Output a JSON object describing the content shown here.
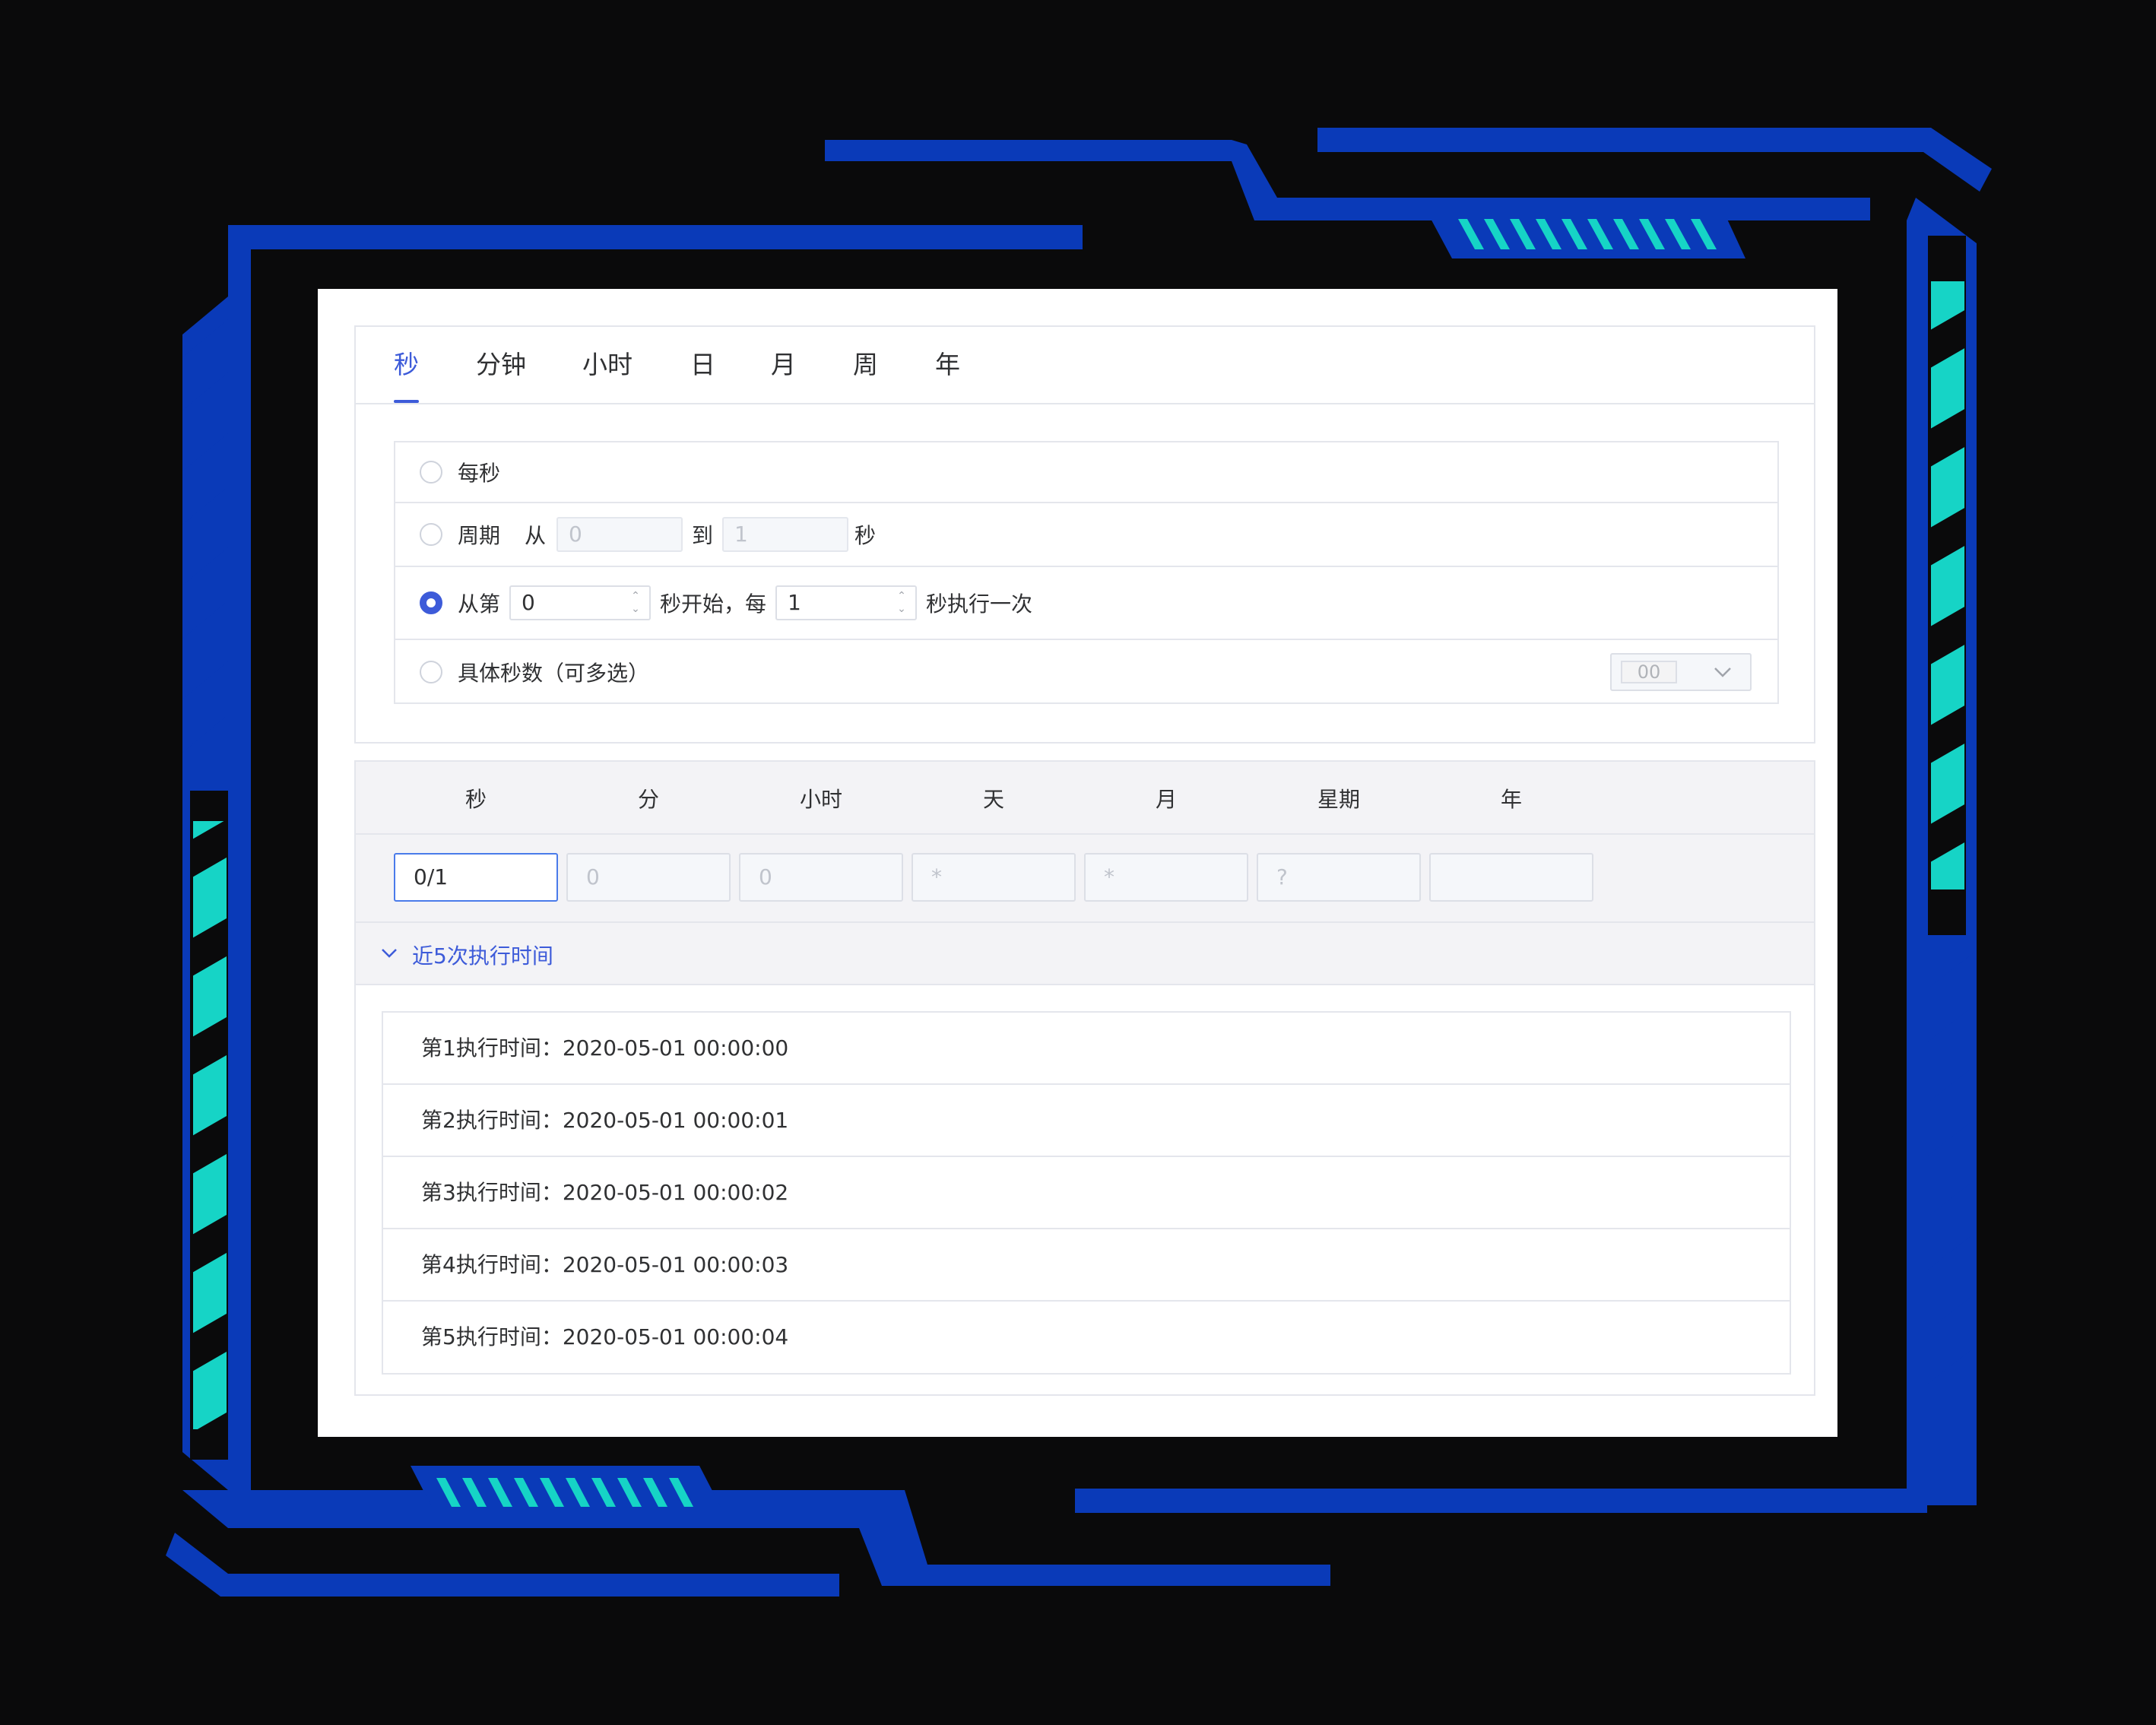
{
  "colors": {
    "frame_blue": "#0a3ab8",
    "accent_teal": "#16d4c6",
    "primary": "#3d5bd9",
    "background": "#0a0a0b"
  },
  "tabs": [
    {
      "label": "秒",
      "active": true
    },
    {
      "label": "分钟"
    },
    {
      "label": "小时"
    },
    {
      "label": "日"
    },
    {
      "label": "月"
    },
    {
      "label": "周"
    },
    {
      "label": "年"
    }
  ],
  "options": {
    "every": {
      "label": "每秒"
    },
    "period": {
      "label": "周期",
      "from_label": "从",
      "from_value": "0",
      "to_label": "到",
      "to_value": "1",
      "unit": "秒"
    },
    "loop": {
      "label": "从第",
      "start_value": "0",
      "mid_label": "秒开始，每",
      "step_value": "1",
      "end_label": "秒执行一次",
      "checked": true
    },
    "specific": {
      "label": "具体秒数（可多选）",
      "select_value": "00"
    }
  },
  "fields": {
    "headers": [
      "秒",
      "分",
      "小时",
      "天",
      "月",
      "星期",
      "年"
    ],
    "values": [
      "0/1",
      "0",
      "0",
      "*",
      "*",
      "?",
      ""
    ]
  },
  "recent": {
    "title": "近5次执行时间",
    "runs": [
      {
        "label": "第1执行时间：",
        "time": "2020-05-01 00:00:00"
      },
      {
        "label": "第2执行时间：",
        "time": "2020-05-01 00:00:01"
      },
      {
        "label": "第3执行时间：",
        "time": "2020-05-01 00:00:02"
      },
      {
        "label": "第4执行时间：",
        "time": "2020-05-01 00:00:03"
      },
      {
        "label": "第5执行时间：",
        "time": "2020-05-01 00:00:04"
      }
    ]
  }
}
